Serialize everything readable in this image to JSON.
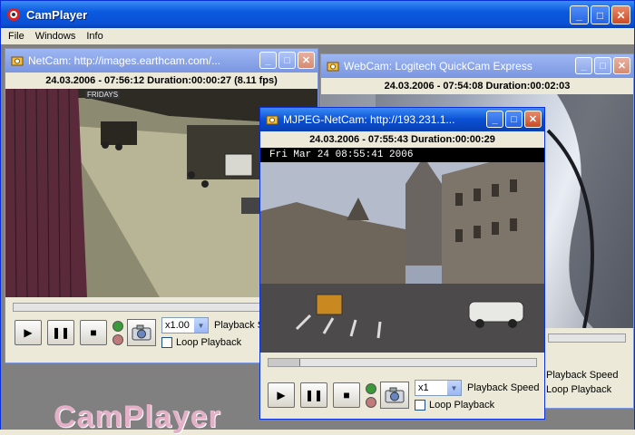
{
  "app": {
    "title": "CamPlayer",
    "watermark": "CamPlayer",
    "menu": [
      "File",
      "Windows",
      "Info"
    ]
  },
  "windows": {
    "netcam": {
      "title": "NetCam: http://images.earthcam.com/...",
      "status": "24.03.2006 - 07:56:12  Duration:00:00:27  (8.11 fps)",
      "speed": "x1.00",
      "speed_label": "Playback Speed",
      "loop_label": "Loop Playback",
      "store_sign": "FRIDAYS"
    },
    "webcam": {
      "title": "WebCam: Logitech QuickCam Express",
      "status": "24.03.2006 - 07:54:08  Duration:00:02:03",
      "speed_label": "Playback Speed",
      "loop_label": "Loop Playback"
    },
    "mjpeg": {
      "title": "MJPEG-NetCam: http://193.231.1...",
      "status": "24.03.2006 - 07:55:43  Duration:00:00:29",
      "overlay": "Fri Mar 24  08:55:41  2006",
      "speed": "x1",
      "speed_label": "Playback Speed",
      "loop_label": "Loop Playback",
      "seek_position": 0.12
    }
  },
  "buttons": {
    "play": "▶",
    "pause": "❚❚",
    "stop": "■",
    "minimize": "_",
    "maximize": "□",
    "close": "✕"
  },
  "colors": {
    "title_active": "#0b50d4",
    "title_inactive": "#7a96df",
    "led_green": "#3a9a3a",
    "led_red": "#c07a7a"
  }
}
